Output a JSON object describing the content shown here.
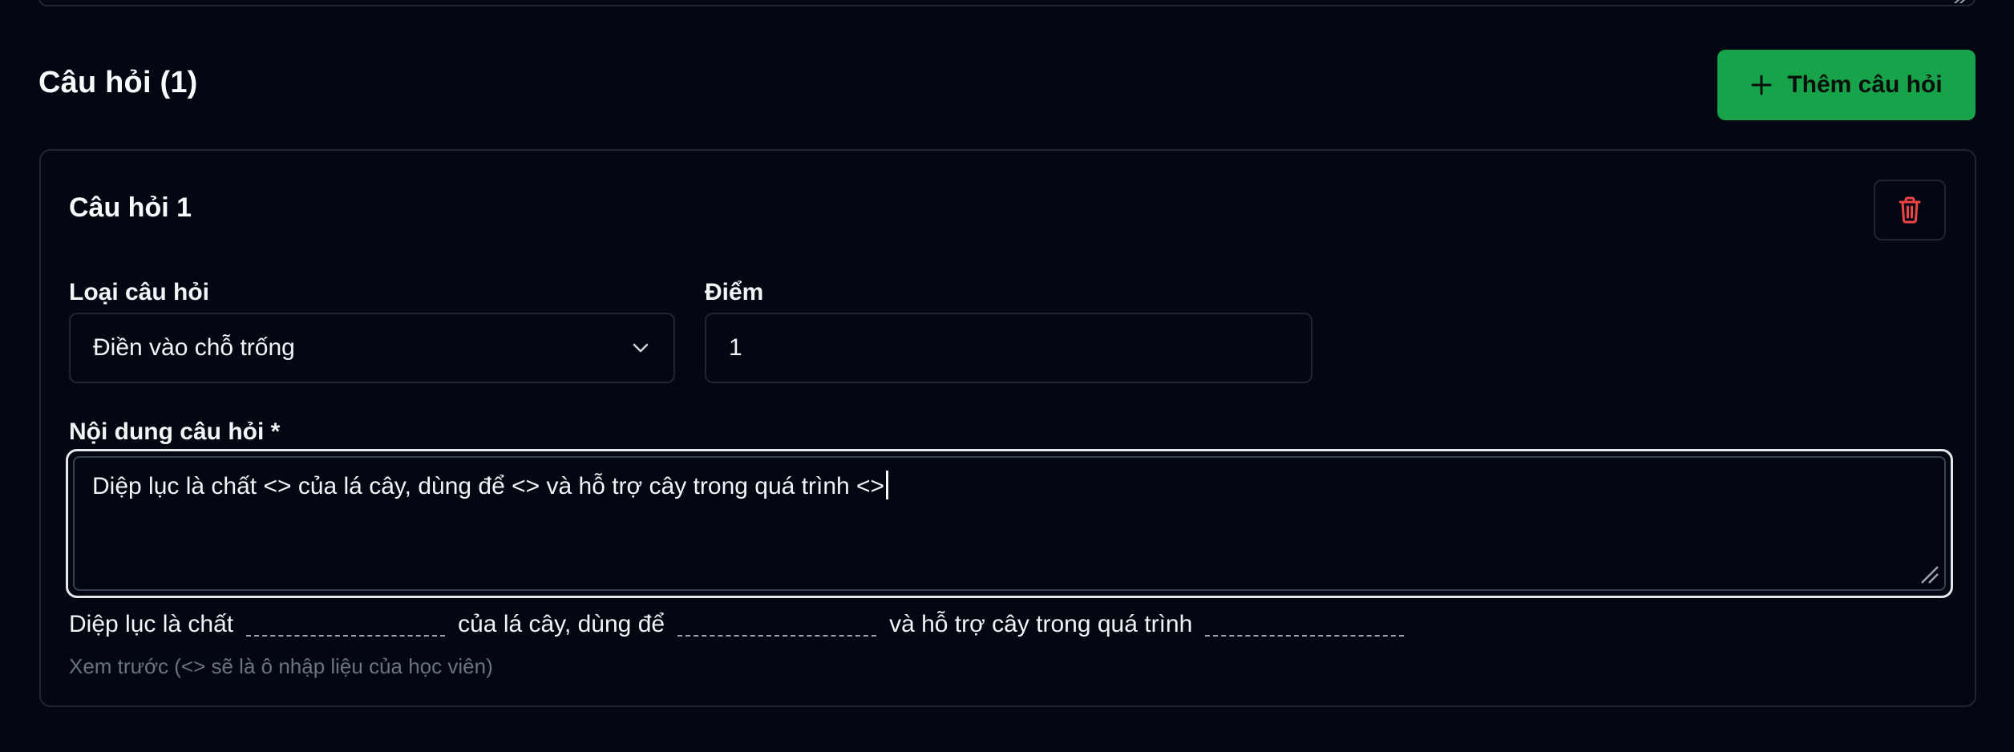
{
  "section": {
    "title": "Câu hỏi (1)",
    "add_button_label": "Thêm câu hỏi"
  },
  "question": {
    "title": "Câu hỏi 1",
    "type_label": "Loại câu hỏi",
    "type_value": "Điền vào chỗ trống",
    "points_label": "Điểm",
    "points_value": "1",
    "content_label": "Nội dung câu hỏi *",
    "content_value": "Diệp lục là chất <> của lá cây, dùng để <> và hỗ trợ cây trong quá trình <>",
    "preview_segments": [
      "Diệp lục là chất",
      "của lá cây, dùng để",
      "và hỗ trợ cây trong quá trình"
    ],
    "preview_hint": "Xem trước (<> sẽ là ô nhập liệu của học viên)"
  },
  "colors": {
    "background": "#030712",
    "accent_green": "#16a34a",
    "delete_red": "#ef4444",
    "border": "#1f2533"
  },
  "icons": {
    "add": "plus-icon",
    "delete": "trash-icon",
    "select": "chevron-down-icon",
    "resize": "resize-grip-icon"
  }
}
